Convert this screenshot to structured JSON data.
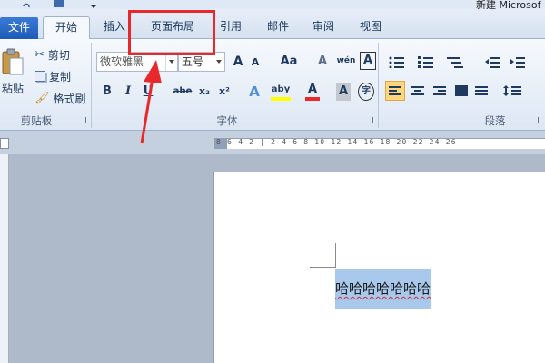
{
  "window": {
    "title": "新建 Microsof"
  },
  "tabs": [
    {
      "label": "文件"
    },
    {
      "label": "开始"
    },
    {
      "label": "插入"
    },
    {
      "label": "页面布局"
    },
    {
      "label": "引用"
    },
    {
      "label": "邮件"
    },
    {
      "label": "审阅"
    },
    {
      "label": "视图"
    }
  ],
  "clipboard": {
    "paste_label": "粘贴",
    "cut_label": "剪切",
    "copy_label": "复制",
    "format_painter_label": "格式刷",
    "group_label": "剪贴板"
  },
  "font": {
    "font_name": "微软雅黑",
    "font_size": "五号",
    "grow_glyph": "A",
    "shrink_glyph": "A",
    "case_glyph": "Aa",
    "clear_glyph": "A",
    "phonetic_glyph": "wén",
    "border_glyph": "A",
    "bold_glyph": "B",
    "italic_glyph": "I",
    "underline_glyph": "U",
    "strike_glyph": "abe",
    "subscript_glyph": "x₂",
    "superscript_glyph": "x²",
    "effects_glyph": "A",
    "highlight_glyph": "aby",
    "color_glyph": "A",
    "shading_glyph": "A",
    "enclose_glyph": "字",
    "group_label": "字体"
  },
  "paragraph": {
    "group_label": "段落"
  },
  "ruler": {
    "text": "8 6 4 2 | 2 4 6 8 10 12 14 16 18 20 22 24 26"
  },
  "document": {
    "selected_text": "哈哈哈哈哈哈哈"
  },
  "colors": {
    "accent": "#2a66c9",
    "annotation": "#e8282b",
    "selection": "#a8c8ec"
  }
}
